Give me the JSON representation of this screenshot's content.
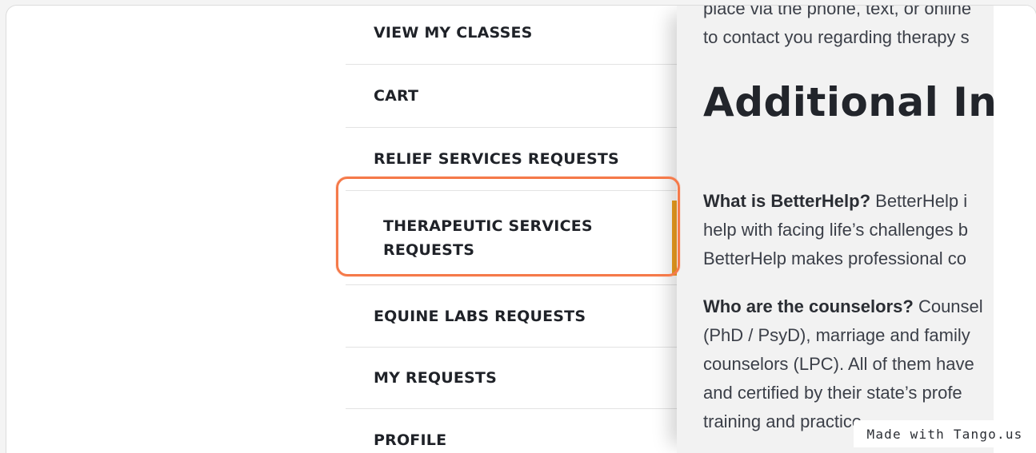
{
  "menu": {
    "items": [
      {
        "label": "VIEW MY CLASSES"
      },
      {
        "label": "CART"
      },
      {
        "label": "RELIEF SERVICES REQUESTS"
      },
      {
        "label": "THERAPEUTIC SERVICES REQUESTS"
      },
      {
        "label": "EQUINE LABS REQUESTS"
      },
      {
        "label": "MY REQUESTS"
      },
      {
        "label": "PROFILE"
      }
    ],
    "active_index": 3
  },
  "content": {
    "intro_lines": [
      "place via the phone, text, or online",
      "to contact you regarding therapy s"
    ],
    "heading": "Additional Inf",
    "paragraph1": {
      "bold": "What is BetterHelp?",
      "lines": [
        " BetterHelp i",
        "help with facing life’s challenges b",
        "BetterHelp makes professional co"
      ]
    },
    "paragraph2": {
      "bold": "Who are the counselors?",
      "lines": [
        " Counsel",
        "(PhD / PsyD), marriage and family",
        "counselors (LPC). All of them have",
        "and certified by their state’s profe",
        "training and practice"
      ]
    }
  },
  "watermark": "Made with Tango.us",
  "colors": {
    "highlight": "#f57a4a",
    "accent_bar": "#f0a020"
  }
}
